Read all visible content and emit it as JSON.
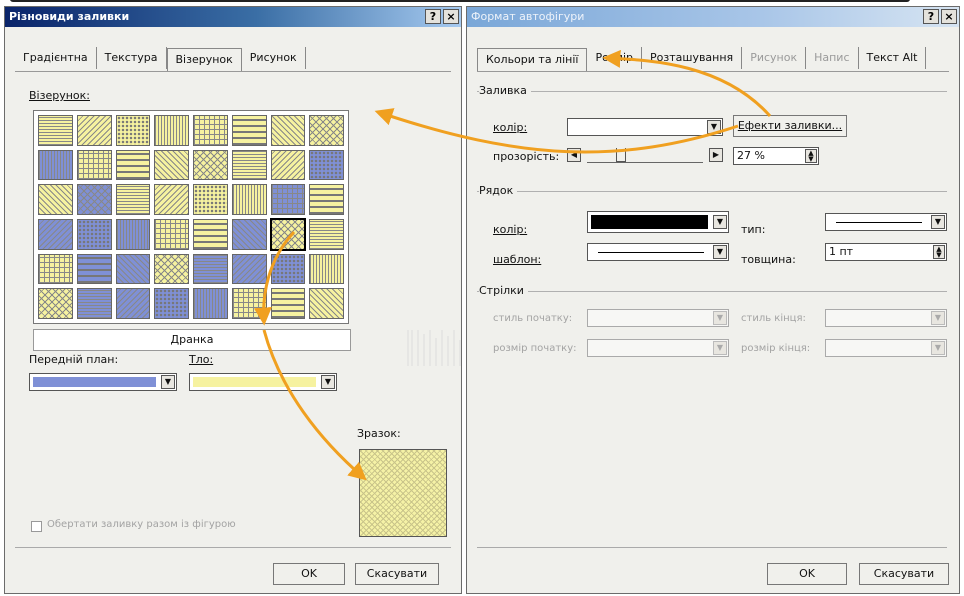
{
  "left_dialog": {
    "title": "Різновиди заливки",
    "help_btn": "?",
    "close_btn": "×",
    "tabs": [
      {
        "label": "Градієнтна"
      },
      {
        "label": "Текстура"
      },
      {
        "label": "Візерунок",
        "active": true
      },
      {
        "label": "Рисунок"
      }
    ],
    "pattern_label": "Візерунок:",
    "selected_pattern_name": "Дранка",
    "foreground_label": "Передній план:",
    "background_label": "Тло:",
    "sample_label": "Зразок:",
    "rotate_checkbox_label": "Обертати заливку разом із фігурою",
    "ok": "OK",
    "cancel": "Скасувати",
    "colors": {
      "foreground": "#7f90d6",
      "background": "#f6f2a0"
    }
  },
  "right_dialog": {
    "title": "Формат автофігури",
    "help_btn": "?",
    "close_btn": "×",
    "tabs": [
      {
        "label": "Кольори та лінії",
        "active": true
      },
      {
        "label": "Розмір"
      },
      {
        "label": "Розташування"
      },
      {
        "label": "Рисунок",
        "disabled": true
      },
      {
        "label": "Напис",
        "disabled": true
      },
      {
        "label": "Текст Alt"
      }
    ],
    "fill": {
      "group": "Заливка",
      "color_label": "колір:",
      "effects_button": "Ефекти заливки...",
      "transparency_label": "прозорість:",
      "transparency_value": "27 %",
      "transparency_fraction": 0.27
    },
    "line": {
      "group": "Рядок",
      "color_label": "колір:",
      "type_label": "тип:",
      "pattern_label": "шаблон:",
      "weight_label": "товщина:",
      "weight_value": "1 пт",
      "color": "#000000"
    },
    "arrows": {
      "group": "Стрілки",
      "begin_style_label": "стиль початку:",
      "end_style_label": "стиль кінця:",
      "begin_size_label": "розмір початку:",
      "end_size_label": "розмір кінця:"
    },
    "ok": "OK",
    "cancel": "Скасувати"
  },
  "annotation": {
    "arrow_color": "#f0a020"
  }
}
